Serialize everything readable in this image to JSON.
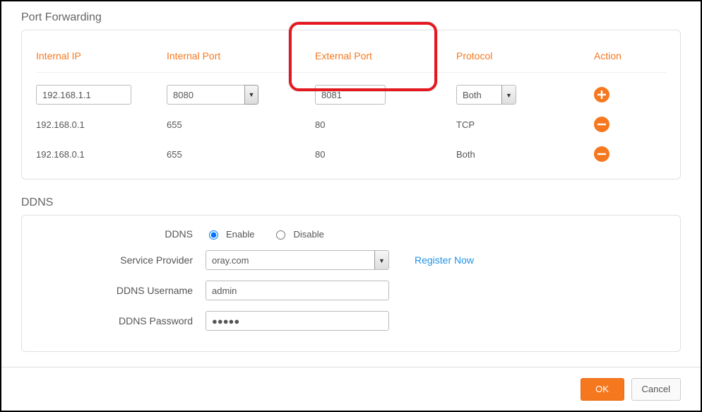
{
  "port_forwarding": {
    "title": "Port Forwarding",
    "headers": {
      "internal_ip": "Internal IP",
      "internal_port": "Internal Port",
      "external_port": "External Port",
      "protocol": "Protocol",
      "action": "Action"
    },
    "input_row": {
      "internal_ip": "192.168.1.1",
      "internal_port": "8080",
      "external_port": "8081",
      "protocol": "Both"
    },
    "rows": [
      {
        "internal_ip": "192.168.0.1",
        "internal_port": "655",
        "external_port": "80",
        "protocol": "TCP"
      },
      {
        "internal_ip": "192.168.0.1",
        "internal_port": "655",
        "external_port": "80",
        "protocol": "Both"
      }
    ]
  },
  "ddns": {
    "title": "DDNS",
    "labels": {
      "ddns": "DDNS",
      "enable": "Enable",
      "disable": "Disable",
      "service_provider": "Service Provider",
      "register_now": "Register Now",
      "username": "DDNS Username",
      "password": "DDNS Password"
    },
    "values": {
      "provider": "oray.com",
      "username": "admin",
      "password": "●●●●●"
    }
  },
  "footer": {
    "ok": "OK",
    "cancel": "Cancel"
  }
}
